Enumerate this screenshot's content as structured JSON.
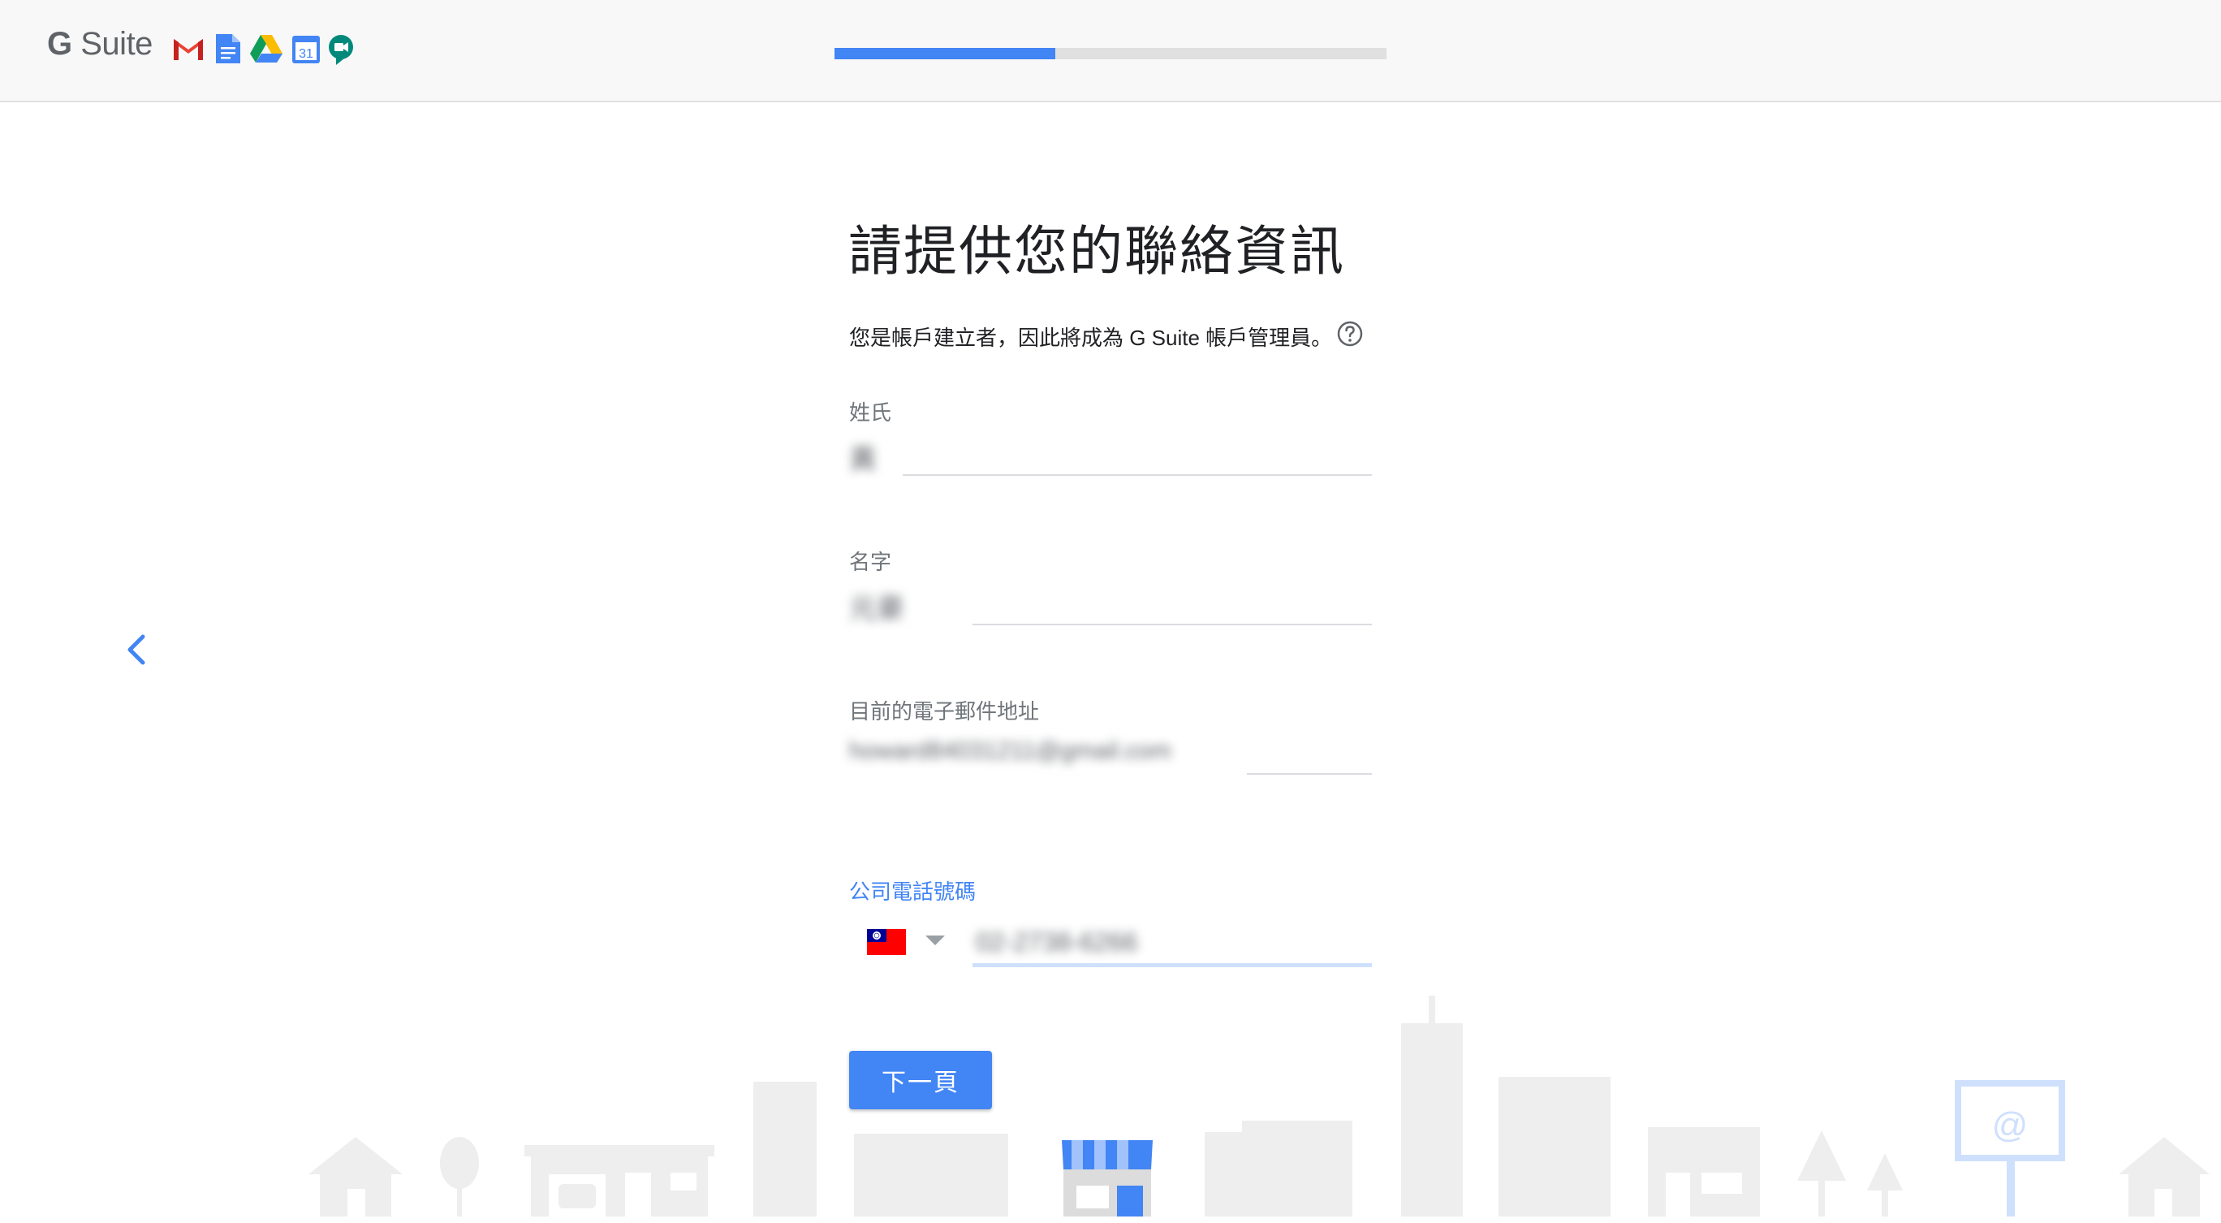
{
  "header": {
    "logo_g": "G",
    "logo_suite": "Suite",
    "apps": [
      "gmail-icon",
      "docs-icon",
      "drive-icon",
      "calendar-icon",
      "meet-icon"
    ],
    "calendar_day": "31",
    "progress": 0.4
  },
  "form": {
    "title": "請提供您的聯絡資訊",
    "subtitle": "您是帳戶建立者，因此將成為 G Suite 帳戶管理員。",
    "fields": {
      "last_name": {
        "label": "姓氏",
        "value": "黃"
      },
      "first_name": {
        "label": "名字",
        "value": "元豪"
      },
      "email": {
        "label": "目前的電子郵件地址",
        "value": "howard84031211@gmail.com"
      },
      "phone": {
        "label": "公司電話號碼",
        "value": "02-2738-6266",
        "country": "Taiwan"
      }
    },
    "next_label": "下一頁"
  },
  "colors": {
    "accent": "#4285f4",
    "progress_track": "#e0e0e0",
    "header_bg": "#f8f8f8",
    "city": "#eeeeee"
  }
}
